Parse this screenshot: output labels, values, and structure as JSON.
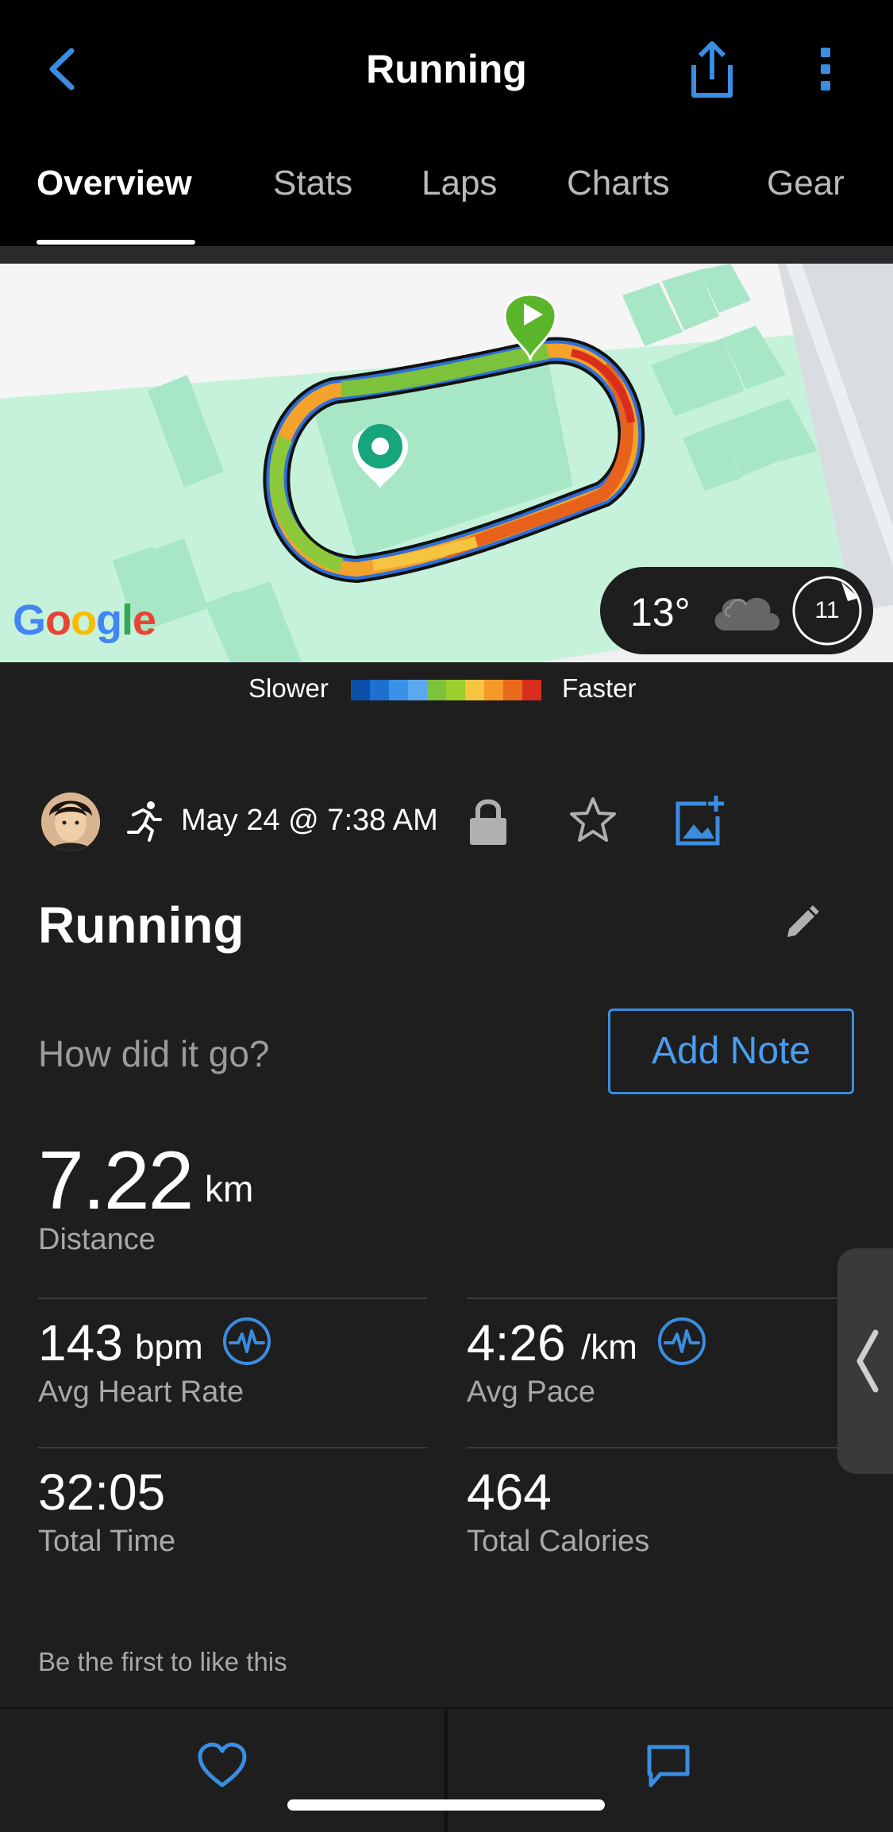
{
  "header": {
    "title": "Running",
    "back_icon": "chevron-left-icon",
    "share_icon": "share-icon",
    "more_icon": "more-vertical-icon"
  },
  "tabs": [
    {
      "label": "Overview",
      "active": true
    },
    {
      "label": "Stats",
      "active": false
    },
    {
      "label": "Laps",
      "active": false
    },
    {
      "label": "Charts",
      "active": false
    },
    {
      "label": "Gear",
      "active": false
    }
  ],
  "map": {
    "provider_logo": "Google",
    "weather": {
      "temperature": "13°",
      "condition_icon": "cloud-icon",
      "wind": "11"
    }
  },
  "legend": {
    "slower": "Slower",
    "faster": "Faster",
    "colors": [
      "#0a4fa8",
      "#1e6fd0",
      "#3a92e8",
      "#5aa8f0",
      "#7cc23a",
      "#9ccf2c",
      "#f5c542",
      "#f59a2a",
      "#ea6a1c",
      "#d92e1e"
    ]
  },
  "activity": {
    "date": "May 24 @ 7:38 AM",
    "name": "Running",
    "how_did_it_go": "How did it go?",
    "add_note": "Add Note",
    "icons": {
      "activity_type": "running-icon",
      "privacy": "lock-icon",
      "favorite": "star-icon",
      "add_photo": "add-photo-icon",
      "edit": "pencil-icon"
    }
  },
  "stats": {
    "distance": {
      "value": "7.22",
      "unit": "km",
      "label": "Distance"
    },
    "avg_heart_rate": {
      "value": "143",
      "unit": "bpm",
      "label": "Avg Heart Rate"
    },
    "avg_pace": {
      "value": "4:26",
      "unit": "/km",
      "label": "Avg Pace"
    },
    "total_time": {
      "value": "32:05",
      "label": "Total Time"
    },
    "total_calories": {
      "value": "464",
      "label": "Total Calories"
    }
  },
  "social": {
    "likes_text": "Be the first to like this",
    "like_icon": "heart-icon",
    "comment_icon": "comment-icon"
  },
  "colors": {
    "accent": "#3a8de0",
    "background": "#1e1e1e",
    "header_bg": "#000000",
    "map_bg": "#c6f2dc"
  }
}
